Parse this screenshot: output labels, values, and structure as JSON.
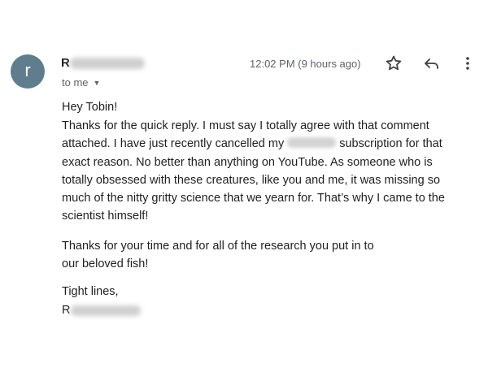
{
  "header": {
    "avatar_letter": "r",
    "sender_visible": "R",
    "recipient": "to me",
    "timestamp": "12:02 PM (9 hours ago)"
  },
  "icons": [
    "star-icon",
    "reply-icon",
    "more-vert-icon"
  ],
  "message": {
    "greeting": "Hey Tobin!",
    "para1": {
      "line1": "Thanks for the quick reply. I must say I totally agree with that comment",
      "line2_a": "attached. I have just recently cancelled my",
      "line2_b": "subscription for that",
      "line3": "exact reason. No better than anything on YouTube. As someone who is",
      "line4": "totally obsessed with these creatures, like you and me, it was missing so",
      "line5": "much of the nitty gritty science that we yearn for. That’s why I came to the",
      "line6": "scientist himself!"
    },
    "para2": {
      "line1": "Thanks for your time and for all of the research you put in to",
      "line2": "our beloved fish!"
    },
    "closing": "Tight lines,",
    "signature_visible": "R"
  }
}
